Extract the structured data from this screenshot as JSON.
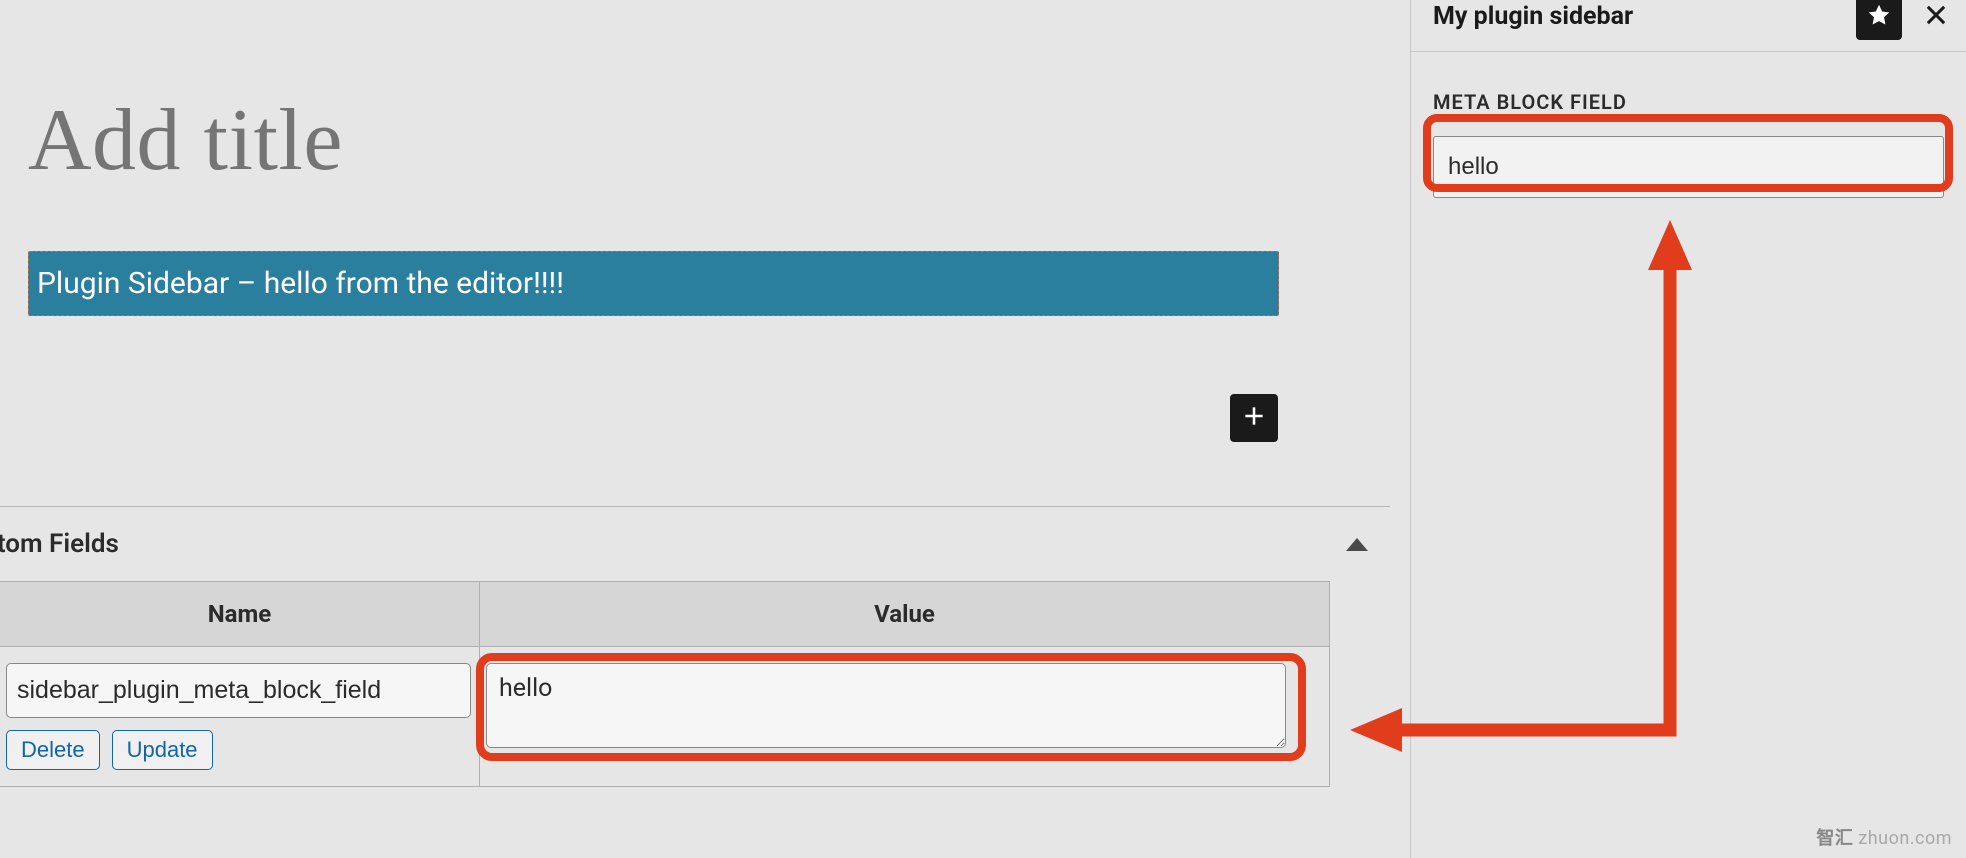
{
  "editor": {
    "title_placeholder": "Add title",
    "block_text": "Plugin Sidebar – hello from the editor!!!!"
  },
  "custom_fields": {
    "panel_title": "Custom Fields",
    "columns": {
      "name": "Name",
      "value": "Value"
    },
    "rows": [
      {
        "name": "sidebar_plugin_meta_block_field",
        "value": "hello"
      }
    ],
    "buttons": {
      "delete": "Delete",
      "update": "Update"
    }
  },
  "sidebar": {
    "title": "My plugin sidebar",
    "field_label": "META BLOCK FIELD",
    "field_value": "hello"
  },
  "watermark": {
    "brand": "智汇",
    "domain": "zhuon.com"
  },
  "colors": {
    "annotation": "#e13d1d",
    "block_bg": "#2b7f9e",
    "link": "#1165a8"
  }
}
